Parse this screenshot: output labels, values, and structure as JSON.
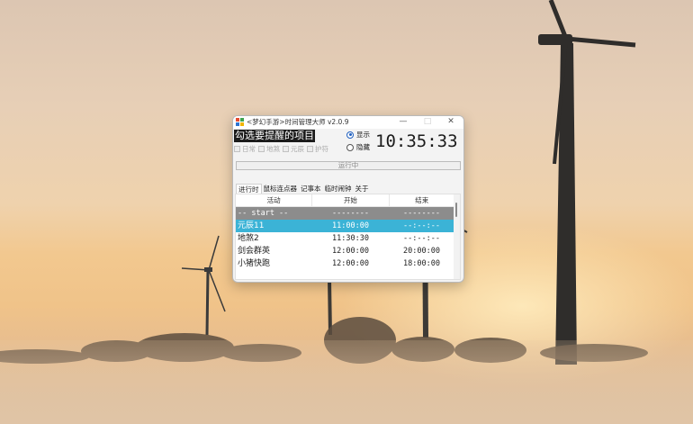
{
  "window": {
    "title": "<梦幻手游>时间管理大师 v2.0.9",
    "minimize_glyph": "—",
    "maximize_glyph": "□",
    "close_glyph": "✕"
  },
  "reminder": {
    "heading": "勾选要提醒的项目",
    "checkboxes": [
      {
        "label": "日常",
        "checked": false,
        "enabled": false
      },
      {
        "label": "地煞",
        "checked": false,
        "enabled": false
      },
      {
        "label": "元辰",
        "checked": false,
        "enabled": false
      },
      {
        "label": "护符",
        "checked": false,
        "enabled": false
      }
    ]
  },
  "display_mode": {
    "options": [
      {
        "label": "显示",
        "selected": true
      },
      {
        "label": "隐藏",
        "selected": false
      }
    ]
  },
  "clock": {
    "time": "10:35:33"
  },
  "status": {
    "label": "运行中"
  },
  "tabs": [
    "进行时",
    "鼠标连点器",
    "记事本",
    "临时闹钟",
    "关于"
  ],
  "active_tab": "进行时",
  "table": {
    "columns": [
      "活动",
      "开始",
      "结束"
    ],
    "rows": [
      {
        "activity": "-- start --",
        "start": "--------",
        "end": "--------",
        "style": "start"
      },
      {
        "activity": "元辰11",
        "start": "11:00:00",
        "end": "--:--:--",
        "style": "selected"
      },
      {
        "activity": "地煞2",
        "start": "11:30:30",
        "end": "--:--:--",
        "style": "normal"
      },
      {
        "activity": "剑会群英",
        "start": "12:00:00",
        "end": "20:00:00",
        "style": "normal"
      },
      {
        "activity": "小猪快跑",
        "start": "12:00:00",
        "end": "18:00:00",
        "style": "normal"
      }
    ]
  },
  "colors": {
    "selected_row": "#3bb3d6",
    "start_row": "#8c8c8c",
    "heading_bg": "#1b1b1b"
  }
}
